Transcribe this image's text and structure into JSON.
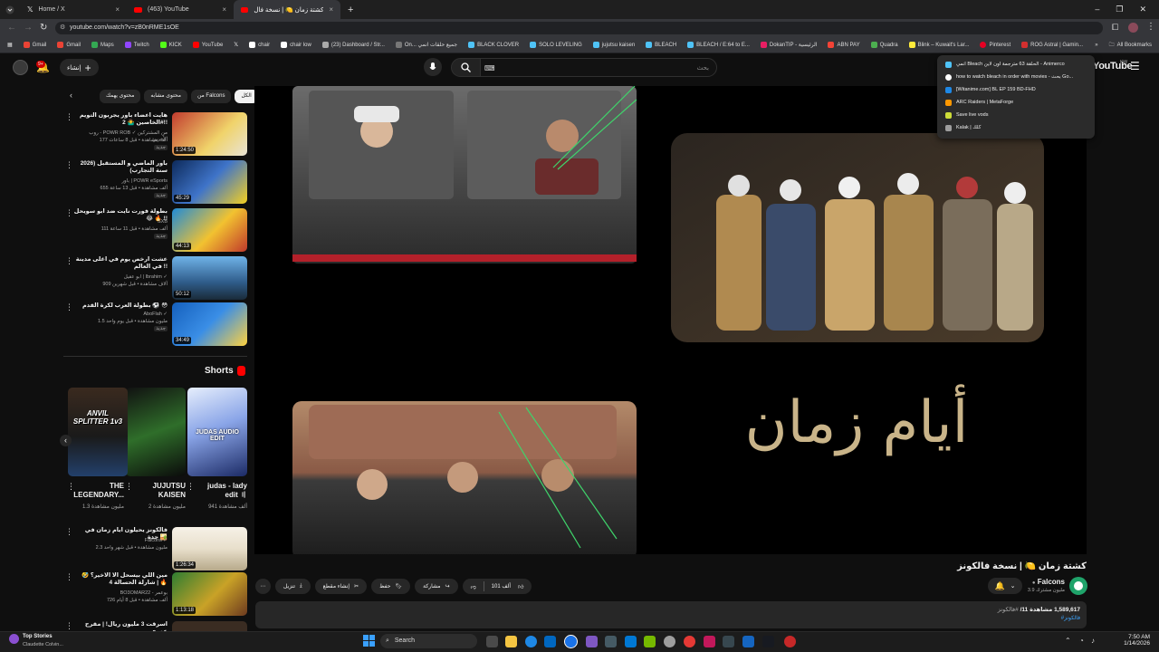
{
  "browser": {
    "tabs": [
      {
        "label": "Home / X",
        "icon": "x-logo-icon"
      },
      {
        "label": "(463) YouTube",
        "icon": "youtube-icon"
      },
      {
        "label": "كشتة زمان 🍋 | نسخة فال...",
        "icon": "youtube-icon",
        "active": true
      }
    ],
    "new_tab": "+",
    "url": "youtube.com/watch?v=zB0nRME1sOE",
    "bookmarks": [
      "Gmail",
      "Gmail",
      "Maps",
      "Twitch",
      "KICK",
      "YouTube",
      "",
      "chair",
      "chair low",
      "(23) Dashboard / Str...",
      "On... جميع حلقات انمي",
      "BLACK CLOVER",
      "SOLO LEVELING",
      "jujutsu kaisen",
      "BLEACH",
      "BLEACH / E:64 to E...",
      "DokanTIP - الرئيسية",
      "ABN PAY",
      "Quadra",
      "Blink – Kuwait's Lar...",
      "Pinterest",
      "ROG Astral | Gamin..."
    ],
    "all_bookmarks": "All Bookmarks",
    "bookmark_popup": [
      "انمي Bleach الحلقة 63 مترجمة اون لاين - Animerco",
      "how to watch bleach in order with movies - بحث Go...",
      "[Witanime.com] BL EP 159 BD-FHD",
      "ARC Raiders | MetaForge",
      "Save live vods",
      "Kalak | كلك"
    ]
  },
  "yt": {
    "create_label": "إنشاء",
    "notif_count": "9+",
    "search_placeholder": "بحث",
    "logo": "YouTube",
    "country": "KW",
    "chips": [
      "الكل",
      "من Falcons",
      "محتوى مشابه",
      "محتوى يهمك"
    ],
    "recommendations": [
      {
        "title": "هايت أعضاء باور يجربون التويم الخاصين 🤷‍♂️ 2#!!",
        "channel": "روب - POWR ROB ✓ من المشتركين الأخرين",
        "meta": "177 ألف مشاهدة • قبل 8 ساعات",
        "badge": "جديد",
        "duration": "1:24:50"
      },
      {
        "title": "باور الماضي و المستقبل (2026 سنة التجارب)",
        "channel": "باور | POWR eSports",
        "meta": "655 ألف مشاهدة • قبل 13 ساعة",
        "badge": "جديد",
        "duration": "45:29"
      },
      {
        "title": "بطولة فورت نايت ضد ابو سويحل 😂 🔥 !!",
        "channel": "SXB",
        "meta": "111 ألف مشاهدة • قبل 11 ساعة",
        "badge": "جديد",
        "duration": "44:13"
      },
      {
        "title": "عشت ارخص يوم في اغلى مدينة في العالم !!",
        "channel": "ابو عقيل | Ibrahim ✓",
        "meta": "909 آلاف مشاهدة • قبل شهرين",
        "badge": "",
        "duration": "50:12"
      },
      {
        "title": "بطولة العرب لكرة القدم ⚽️ 😳",
        "channel": "AboFlah ✓",
        "meta": "1.5 مليون مشاهدة • قبل يوم واحد",
        "badge": "جديد",
        "duration": "34:49"
      }
    ],
    "shorts_title": "Shorts",
    "shorts": [
      {
        "title": "judas - lady edit 〢",
        "views": "941 ألف مشاهدة",
        "overlay": "JUDAS AUDIO EDIT"
      },
      {
        "title": "JUJUTSU KAISEN",
        "views": "2 مليون مشاهدة",
        "overlay": ""
      },
      {
        "title": "THE LEGENDARY...",
        "views": "1.3 مليون مشاهدة",
        "overlay": "ANVIL SPLITTER 1v3"
      }
    ],
    "more_recs": [
      {
        "title": "فالكونز يحيلون أيام زمان في جدة 🏜️",
        "channel": "Falcons ✓",
        "meta": "2.3 مليون مشاهدة • قبل شهر واحد",
        "duration": "1:26:34"
      },
      {
        "title": "مين اللي بيسحل الا الاخير؟ 🤣 🔥 | شارلة الحسالة 4",
        "channel": "BO3OMAR22 - بوعمر",
        "meta": "726 ألف مشاهدة • قبل 8 أيام",
        "duration": "1:13:18"
      },
      {
        "title": "اسرقت 3 مليون ريال! | مقرح عمري",
        "channel": "",
        "meta": "",
        "duration": ""
      }
    ],
    "video": {
      "title": "كشتة زمان 🍋 | نسخة فالكونز",
      "channel": "Falcons",
      "subs": "3.9 مليون مشترك",
      "views": "1,589,617 مشاهدة",
      "date": "11/",
      "hashtags": "#فالكونز",
      "hashtag2": "#فالكونز",
      "likes": "101 ألف",
      "share": "مشاركة",
      "save": "حفظ",
      "clip": "إنشاء مقطع",
      "download": "تنزيل",
      "title_art": "أيام زمان"
    }
  },
  "taskbar": {
    "news_title": "Top Stories",
    "news_sub": "Claudette Colvin...",
    "search": "Search",
    "time": "7:50 AM",
    "date": "1/14/2026"
  }
}
